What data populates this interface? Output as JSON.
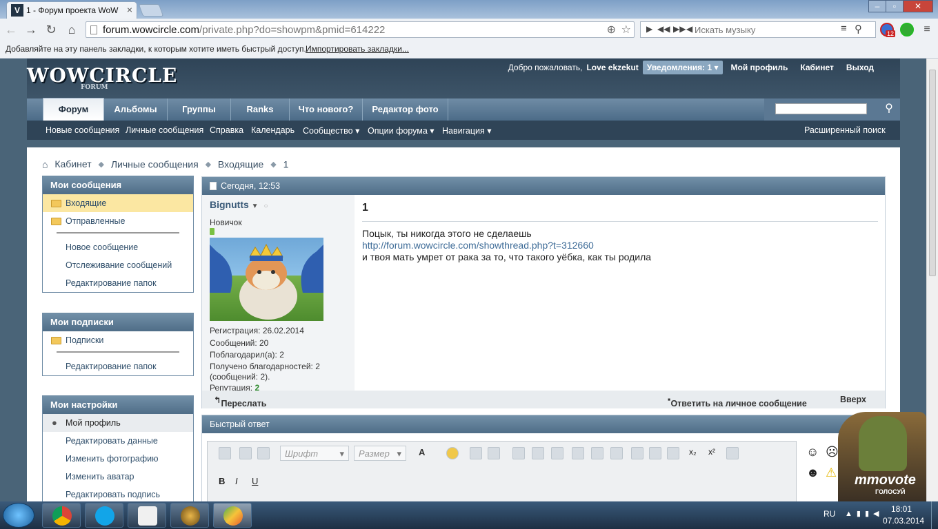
{
  "browser": {
    "tab_title": "1 - Форум проекта WoW",
    "tab_close": "×",
    "url_host": "forum.wowcircle.com",
    "url_path": "/private.php?do=showpm&pmid=614222",
    "music_placeholder": "Искать музыку",
    "bookmarks_text": "Добавляйте на эту панель закладки, к которым хотите иметь быстрый доступ.",
    "bookmarks_link": "Импортировать закладки...",
    "ext_badge": "12"
  },
  "header": {
    "logo": "WOWCIRCLE",
    "logo_sub": "FORUM",
    "welcome": "Добро пожаловать,",
    "username": "Love ekzekut",
    "notifications": "Уведомления: 1",
    "profile": "Мой профиль",
    "cabinet": "Кабинет",
    "logout": "Выход"
  },
  "navtabs": [
    "Форум",
    "Альбомы",
    "Группы",
    "Ranks",
    "Что нового?",
    "Редактор фото"
  ],
  "subnav": {
    "items": [
      "Новые сообщения",
      "Личные сообщения",
      "Справка",
      "Календарь",
      "Сообщество",
      "Опции форума",
      "Навигация"
    ],
    "advanced_search": "Расширенный поиск"
  },
  "breadcrumb": {
    "items": [
      "Кабинет",
      "Личные сообщения",
      "Входящие",
      "1"
    ]
  },
  "sidebar": {
    "messages": {
      "title": "Мои сообщения",
      "folders": [
        "Входящие",
        "Отправленные"
      ],
      "links": [
        "Новое сообщение",
        "Отслеживание сообщений",
        "Редактирование папок"
      ]
    },
    "subscriptions": {
      "title": "Мои подписки",
      "folders": [
        "Подписки"
      ],
      "links": [
        "Редактирование папок"
      ]
    },
    "settings": {
      "title": "Мои настройки",
      "profile": "Мой профиль",
      "links": [
        "Редактировать данные",
        "Изменить фотографию",
        "Изменить аватар",
        "Редактировать подпись"
      ]
    }
  },
  "post": {
    "date": "Сегодня, 12:53",
    "author": {
      "name": "Bignutts",
      "title": "Новичок",
      "registration": "Регистрация:   26.02.2014",
      "messages": "Сообщений:   20",
      "thanked": "Поблагодарил(а):   2",
      "thanks_received": "Получено благодарностей: 2",
      "thanks_posts": "(сообщений: 2).",
      "reputation_label": "Репутация:",
      "reputation_value": "2"
    },
    "title": "1",
    "lines": [
      "Поцык, ты никогда этого не сделаешь",
      "http://forum.wowcircle.com/showthread.php?t=312660",
      "и твоя мать умрет от рака за то, что такого уёбка, как ты родила"
    ],
    "forward": "Переслать",
    "reply": "Ответить на личное сообщение",
    "top": "Вверх"
  },
  "quick_reply": {
    "title": "Быстрый ответ",
    "font_placeholder": "Шрифт",
    "size_placeholder": "Размер"
  },
  "vote_badge": {
    "text": "mmovote",
    "sub": "ГОЛОСУЙ"
  },
  "taskbar": {
    "lang": "RU",
    "time": "18:01",
    "date": "07.03.2014"
  },
  "colors": {
    "header_dark": "#2f4457",
    "block_header": "#5f7d96",
    "link": "#2f4e6a",
    "selected_folder": "#fbe7a2",
    "reputation": "#2e8b2e"
  }
}
